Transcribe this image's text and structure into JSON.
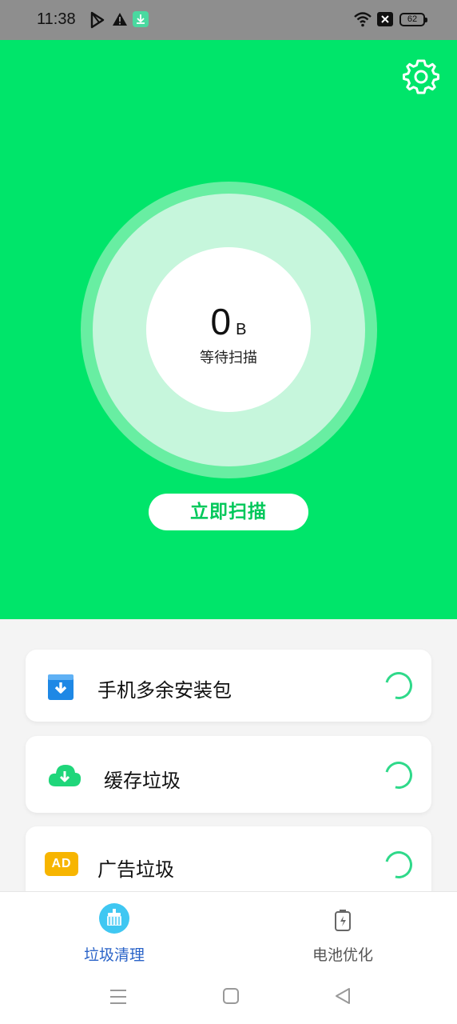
{
  "status_bar": {
    "time": "11:38",
    "battery": "62",
    "icons": [
      "play-store-icon",
      "warning-icon",
      "download-icon",
      "wifi-icon",
      "no-sim-icon",
      "battery-icon"
    ]
  },
  "header": {
    "settings_icon": "gear-icon"
  },
  "scan": {
    "size_value": "0",
    "size_unit": "B",
    "status": "等待扫描",
    "button_label": "立即扫描"
  },
  "categories": [
    {
      "label": "手机多余安装包",
      "icon": "apk-package-icon"
    },
    {
      "label": "缓存垃圾",
      "icon": "cloud-download-icon"
    },
    {
      "label": "广告垃圾",
      "icon": "ad-icon",
      "icon_text": "AD"
    }
  ],
  "bottom_nav": {
    "tabs": [
      {
        "label": "垃圾清理",
        "icon": "broom-icon",
        "active": true
      },
      {
        "label": "电池优化",
        "icon": "battery-charge-icon",
        "active": false
      }
    ]
  },
  "colors": {
    "brand_green": "#00e56a",
    "active_tab": "#2b64c8",
    "inactive_tab": "#555555",
    "ad_badge": "#f7b500",
    "package_blue": "#1e88e5",
    "cloud_green": "#1fd67a"
  }
}
